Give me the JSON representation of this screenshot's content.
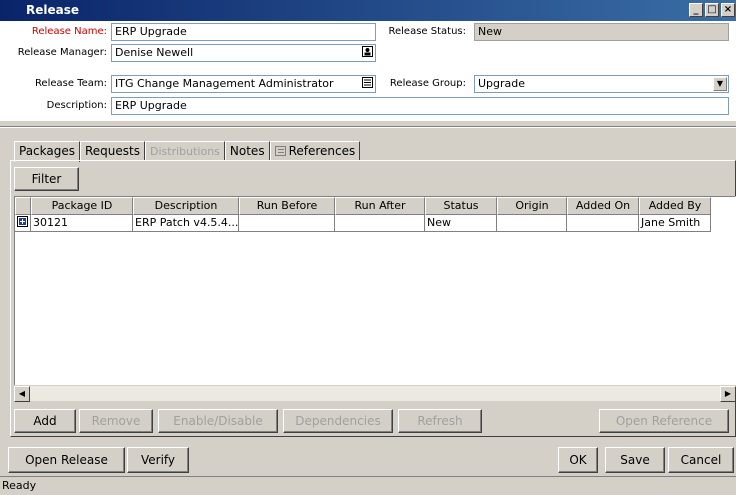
{
  "window": {
    "title": "Release",
    "min_glyph": "_",
    "max_glyph": "□",
    "close_glyph": "×"
  },
  "form": {
    "release_name": {
      "label": "Release Name:",
      "value": "ERP Upgrade"
    },
    "release_status": {
      "label": "Release Status:",
      "value": "New"
    },
    "release_manager": {
      "label": "Release Manager:",
      "value": "Denise Newell",
      "icon": "user-lookup-icon"
    },
    "release_team": {
      "label": "Release Team:",
      "value": "ITG Change Management Administrator",
      "icon": "list-lookup-icon"
    },
    "release_group": {
      "label": "Release Group:",
      "value": "Upgrade"
    },
    "description": {
      "label": "Description:",
      "value": "ERP Upgrade"
    }
  },
  "tabs": [
    {
      "label": "Packages",
      "active": true,
      "disabled": false
    },
    {
      "label": "Requests",
      "active": false,
      "disabled": false
    },
    {
      "label": "Distributions",
      "active": false,
      "disabled": true
    },
    {
      "label": "Notes",
      "active": false,
      "disabled": false
    },
    {
      "label": "References",
      "active": false,
      "disabled": false
    }
  ],
  "packages": {
    "filter_label": "Filter",
    "columns": [
      "Package ID",
      "Description",
      "Run Before",
      "Run After",
      "Status",
      "Origin",
      "Added On",
      "Added By"
    ],
    "rows": [
      {
        "package_id": "30121",
        "description": "ERP Patch v4.5.4...",
        "run_before": "",
        "run_after": "",
        "status": "New",
        "origin": "",
        "added_on": "",
        "added_by": "Jane Smith"
      }
    ],
    "actions": {
      "add": "Add",
      "remove": "Remove",
      "enable_disable": "Enable/Disable",
      "dependencies": "Dependencies",
      "refresh": "Refresh",
      "open_reference": "Open Reference"
    }
  },
  "footer": {
    "open_release": "Open Release",
    "verify": "Verify",
    "ok": "OK",
    "save": "Save",
    "cancel": "Cancel"
  },
  "status_bar": {
    "text": "Ready"
  },
  "colors": {
    "required_label": "#cc0000",
    "title_bar": "#0a246a",
    "window_bg": "#d4d0c8"
  }
}
